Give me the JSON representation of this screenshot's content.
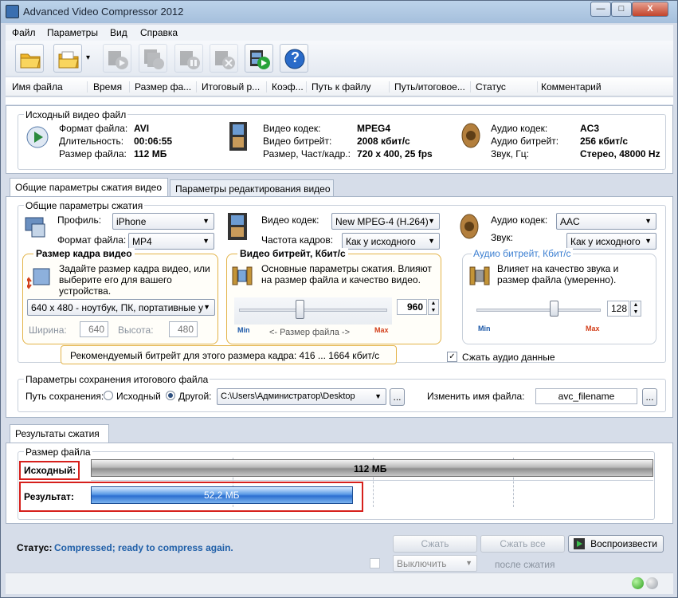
{
  "window": {
    "title": "Advanced Video Compressor 2012",
    "min": "—",
    "max": "□",
    "close": "X"
  },
  "menu": [
    "Файл",
    "Параметры",
    "Вид",
    "Справка"
  ],
  "columns": [
    "Имя файла",
    "Время",
    "Размер фа...",
    "Итоговый р...",
    "Коэф...",
    "Путь к файлу",
    "Путь/итоговое...",
    "Статус",
    "Комментарий"
  ],
  "toolbar": {
    "add_file": "folder-add-icon",
    "add_folder": "folder-open-icon",
    "dropdown": "▾",
    "help": "?"
  },
  "source": {
    "group": "Исходный видео файл",
    "format_label": "Формат файла:",
    "format": "AVI",
    "duration_label": "Длительность:",
    "duration": "00:06:55",
    "size_label": "Размер файла:",
    "size": "112 МБ",
    "vcodec_label": "Видео кодек:",
    "vcodec": "MPEG4",
    "vbitrate_label": "Видео битрейт:",
    "vbitrate": "2008 кбит/с",
    "dims_label": "Размер, Част/кадр.:",
    "dims": "720 x 400, 25 fps",
    "acodec_label": "Аудио кодек:",
    "acodec": "AC3",
    "abitrate_label": "Аудио битрейт:",
    "abitrate": "256 кбит/с",
    "sound_label": "Звук, Гц:",
    "sound": "Стерео, 48000 Hz"
  },
  "tabs": {
    "general": "Общие параметры сжатия видео",
    "edit": "Параметры редактирования видео"
  },
  "compression": {
    "group": "Общие параметры сжатия",
    "profile_label": "Профиль:",
    "profile": "iPhone",
    "format_label": "Формат файла:",
    "format": "MP4",
    "frame_title": "Размер кадра видео",
    "frame_desc": "Задайте размер кадра видео, или выберите его для вашего устройства.",
    "frame_preset": "640 x 480 - ноутбук, ПК, портативные у",
    "width_label": "Ширина:",
    "width": "640",
    "height_label": "Высота:",
    "height": "480",
    "recommend": "Рекомендуемый битрейт для этого размера кадра: 416 ... 1664 кбит/с",
    "vcodec_label": "Видео кодек:",
    "vcodec": "New MPEG-4 (H.264)",
    "fps_label": "Частота кадров:",
    "fps": "Как у исходного",
    "vbitrate_title": "Видео битрейт, Кбит/с",
    "vbitrate_desc": "Основные параметры сжатия. Влияют на размер файла и качество видео.",
    "vbitrate": "960",
    "vbitrate_level": 0.41,
    "min": "Min",
    "max": "Max",
    "size_hint": "<-  Размер файла  ->",
    "acodec_label": "Аудио кодек:",
    "acodec": "AAC",
    "sound_label": "Звук:",
    "sound": "Как у исходного",
    "abitrate_title": "Аудио битрейт, Кбит/с",
    "abitrate_desc": "Влияет на качество звука и размер файла (умеренно).",
    "abitrate": "128",
    "abitrate_level": 0.62,
    "compress_audio": "Сжать аудио данные",
    "compress_audio_checked": "✓"
  },
  "save": {
    "group": "Параметры сохранения итогового файла",
    "path_label": "Путь сохранения:",
    "opt_source": "Исходный",
    "opt_other": "Другой:",
    "path": "C:\\Users\\Администратор\\Desktop",
    "browse": "...",
    "rename_label": "Изменить имя файла:",
    "rename": "avc_filename",
    "rename_btn": "..."
  },
  "results": {
    "tab": "Результаты сжатия",
    "group": "Размер файла",
    "source_label": "Исходный:",
    "source_value": "112 МБ",
    "result_label": "Результат:",
    "result_value": "52,2 МБ",
    "result_fraction": 0.466
  },
  "status": {
    "label": "Статус:",
    "text": "Compressed; ready to compress again.",
    "compress": "Сжать",
    "compress_all": "Сжать все",
    "play": "Воспроизвести",
    "after_option": "Выключить",
    "after_label": "после сжатия"
  },
  "colors": {
    "accent": "#3c7fd1",
    "link": "#1c58a8",
    "status_text": "#1f5fa8",
    "orange": "#e3b348",
    "red": "#d6201c"
  }
}
